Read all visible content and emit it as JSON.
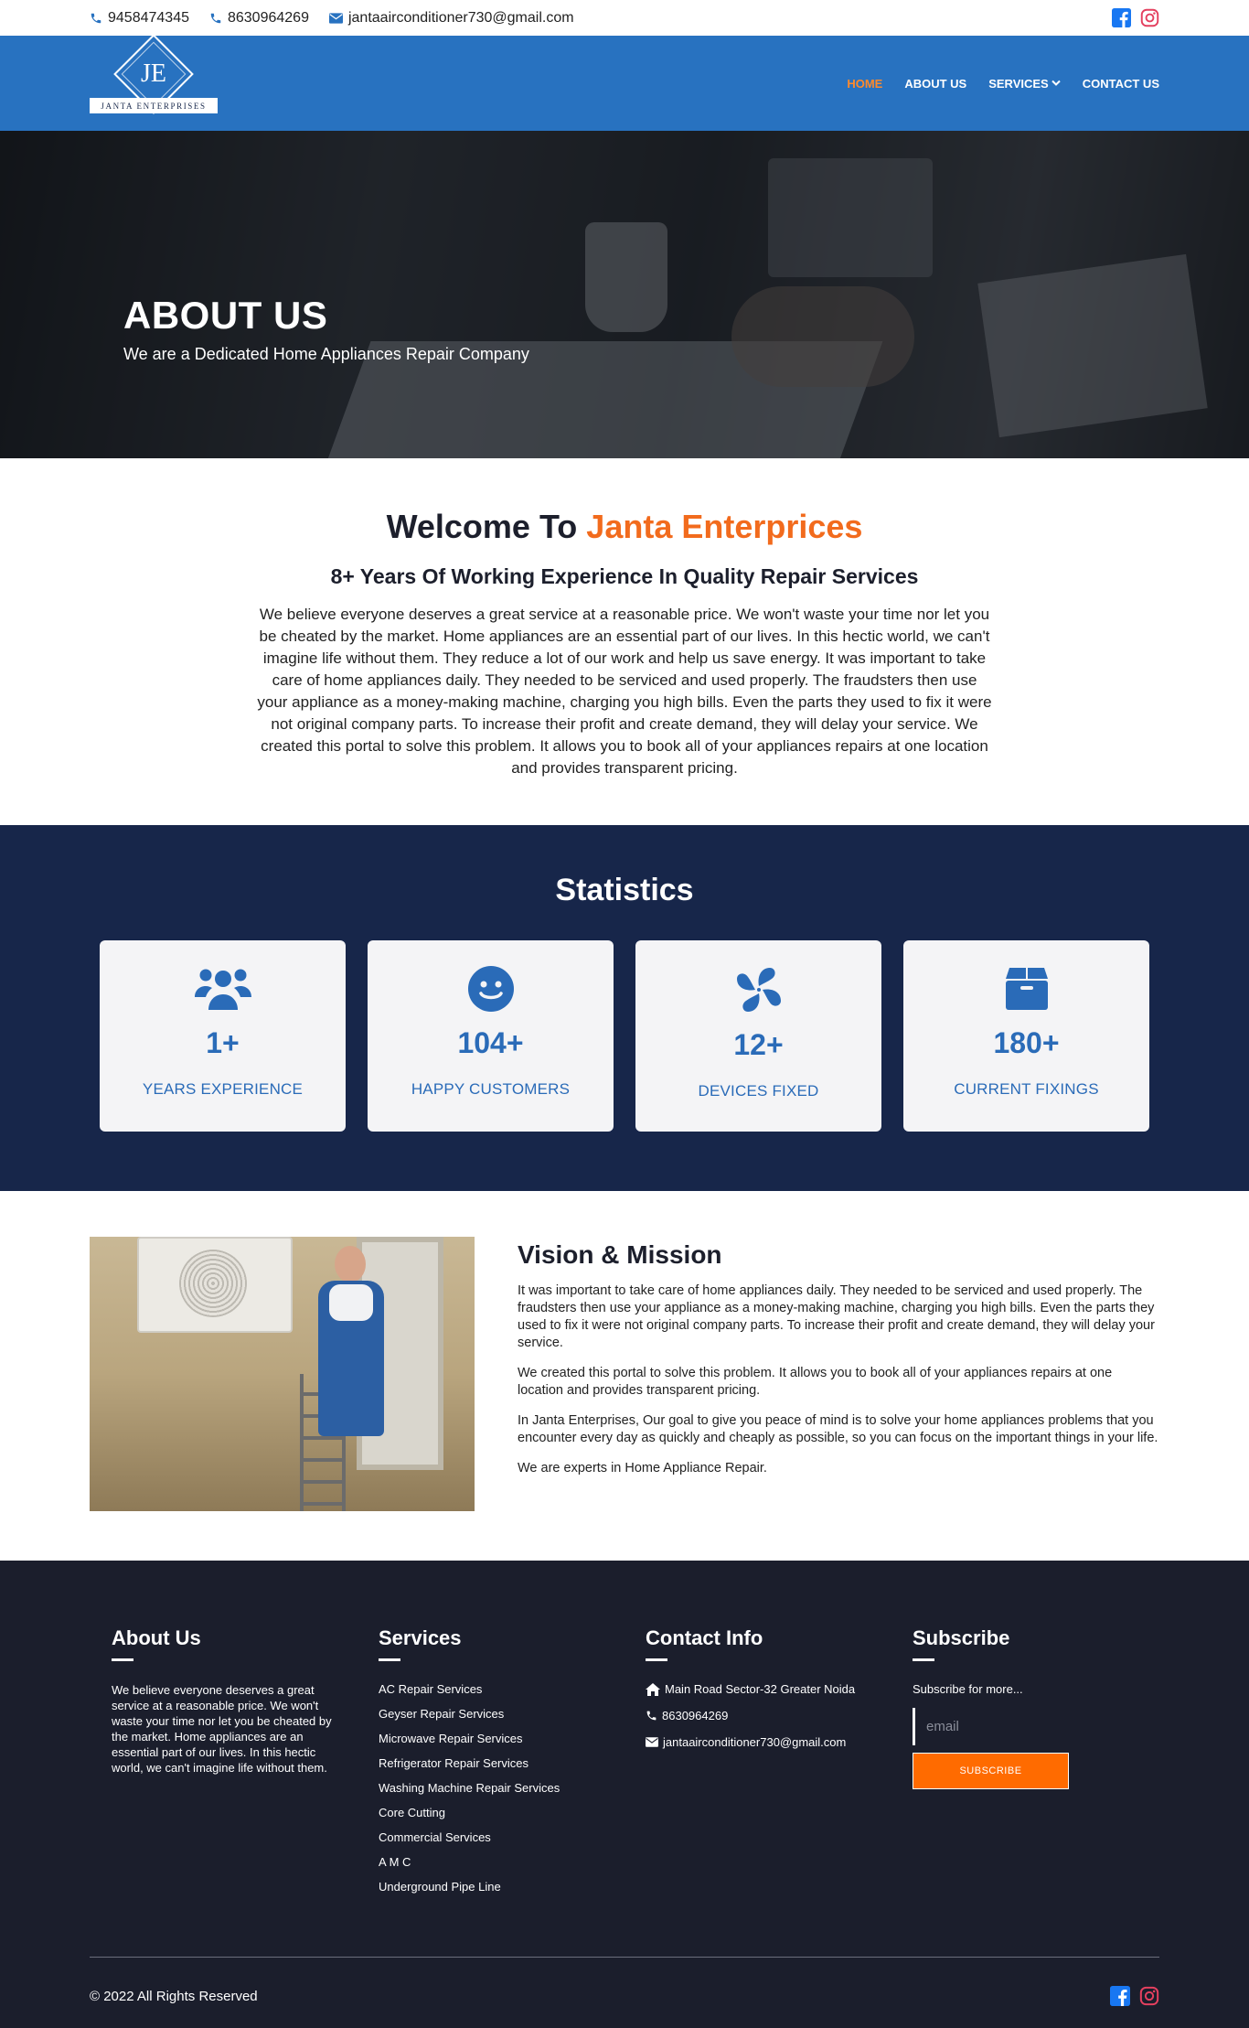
{
  "topbar": {
    "phone1": "9458474345",
    "phone2": "8630964269",
    "email": "jantaairconditioner730@gmail.com"
  },
  "logo": {
    "monogram": "JE",
    "brand": "JANTA ENTERPRISES"
  },
  "nav": {
    "items": [
      {
        "label": "HOME",
        "active": true
      },
      {
        "label": "ABOUT US"
      },
      {
        "label": "SERVICES"
      },
      {
        "label": "CONTACT US"
      }
    ]
  },
  "hero": {
    "title": "ABOUT US",
    "subtitle": "We are a Dedicated Home Appliances Repair Company"
  },
  "welcome": {
    "title_prefix": "Welcome To",
    "title_accent": "Janta Enterprices",
    "subtitle": "8+ Years Of Working Experience In Quality Repair Services",
    "body": "We believe everyone deserves a great service at a reasonable price. We won't waste your time nor let you be cheated by the market. Home appliances are an essential part of our lives. In this hectic world, we can't imagine life without them. They reduce a lot of our work and help us save energy. It was important to take care of home appliances daily. They needed to be serviced and used properly. The fraudsters then use your appliance as a money-making machine, charging you high bills. Even the parts they used to fix it were not original company parts. To increase their profit and create demand, they will delay your service. We created this portal to solve this problem. It allows you to book all of your appliances repairs at one location and provides transparent pricing."
  },
  "stats": {
    "title": "Statistics",
    "cards": [
      {
        "value": "1+",
        "label": "YEARS EXPERIENCE",
        "icon": "users-icon"
      },
      {
        "value": "104+",
        "label": "HAPPY CUSTOMERS",
        "icon": "smile-icon"
      },
      {
        "value": "12+",
        "label": "DEVICES FIXED",
        "icon": "fan-icon"
      },
      {
        "value": "180+",
        "label": "CURRENT FIXINGS",
        "icon": "box-icon"
      }
    ]
  },
  "vision": {
    "title": "Vision & Mission",
    "paragraphs": [
      "It was important to take care of home appliances daily. They needed to be serviced and used properly. The fraudsters then use your appliance as a money-making machine, charging you high bills. Even the parts they used to fix it were not original company parts. To increase their profit and create demand, they will delay your service.",
      "We created this portal to solve this problem. It allows you to book all of your appliances repairs at one location and provides transparent pricing.",
      "In Janta Enterprises, Our goal to give you peace of mind is to solve your home appliances problems that you encounter every day as quickly and cheaply as possible, so you can focus on the important things in your life.",
      "We are experts in Home Appliance Repair."
    ]
  },
  "footer": {
    "about": {
      "title": "About Us",
      "text": "We believe everyone deserves a great service at a reasonable price. We won't waste your time nor let you be cheated by the market. Home appliances are an essential part of our lives. In this hectic world, we can't imagine life without them."
    },
    "services": {
      "title": "Services",
      "items": [
        "AC Repair Services",
        "Geyser Repair Services",
        "Microwave Repair Services",
        "Refrigerator Repair Services",
        "Washing Machine Repair Services",
        "Core Cutting",
        "Commercial Services",
        "A M C",
        "Underground Pipe Line"
      ]
    },
    "contact": {
      "title": "Contact Info",
      "address": "Main Road Sector-32 Greater Noida",
      "phone": "8630964269",
      "email": "jantaairconditioner730@gmail.com"
    },
    "subscribe": {
      "title": "Subscribe",
      "text": "Subscribe for more...",
      "placeholder": "email",
      "button": "SUBSCRIBE"
    },
    "copyright": "© 2022 All Rights Reserved"
  },
  "colors": {
    "nav_bg": "#2872c0",
    "accent": "#f26b1d",
    "stats_bg": "#17264a",
    "footer_bg": "#1b1e2c",
    "stat_blue": "#2a6bb8",
    "facebook": "#1877f2",
    "instagram": "#e4405f"
  }
}
